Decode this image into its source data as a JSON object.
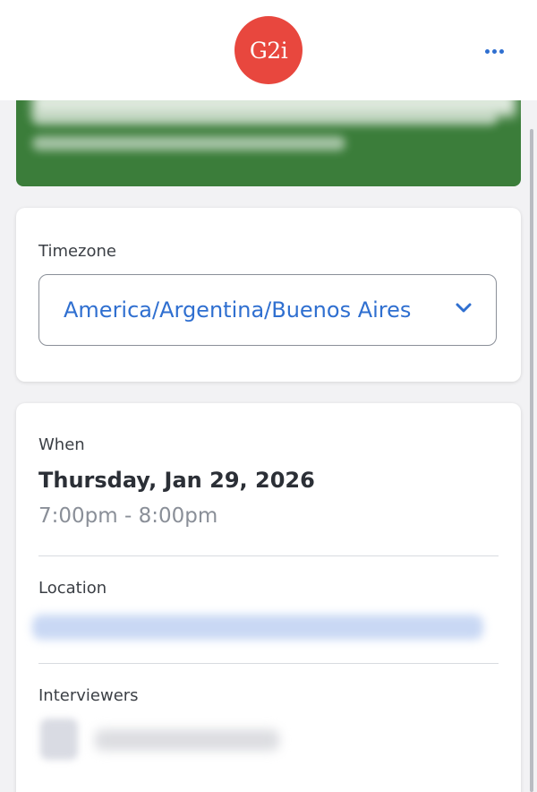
{
  "header": {
    "logo_text": "G2i",
    "more_icon": "more-horizontal-icon"
  },
  "timezone": {
    "label": "Timezone",
    "value": "America/Argentina/Buenos Aires",
    "dropdown_icon": "chevron-down-icon"
  },
  "when": {
    "label": "When",
    "date": "Thursday, Jan 29, 2026",
    "time": "7:00pm - 8:00pm"
  },
  "location": {
    "label": "Location"
  },
  "interviewers": {
    "label": "Interviewers"
  },
  "colors": {
    "brand_red": "#e8473e",
    "banner_green": "#3b7d3a",
    "link_blue": "#2f6fd0",
    "background": "#f2f2f4"
  }
}
